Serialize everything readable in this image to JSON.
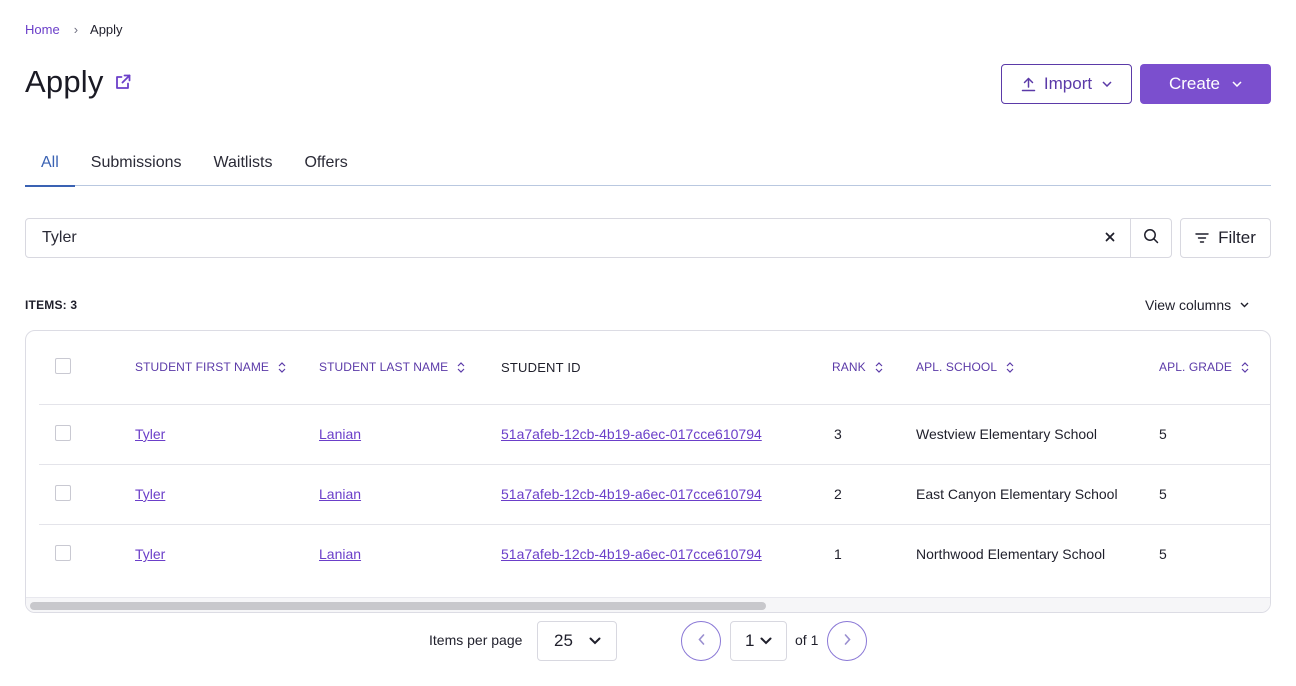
{
  "breadcrumb": {
    "home": "Home",
    "separator": "›",
    "current": "Apply"
  },
  "page": {
    "title": "Apply"
  },
  "header": {
    "import_label": "Import",
    "create_label": "Create"
  },
  "tabs": [
    {
      "label": "All",
      "active": true
    },
    {
      "label": "Submissions",
      "active": false
    },
    {
      "label": "Waitlists",
      "active": false
    },
    {
      "label": "Offers",
      "active": false
    }
  ],
  "search": {
    "value": "Tyler",
    "clear_symbol": "×"
  },
  "filter": {
    "label": "Filter"
  },
  "items": {
    "count_label": "ITEMS: 3"
  },
  "view_columns": {
    "label": "View columns"
  },
  "table": {
    "columns": [
      {
        "label": "STUDENT FIRST NAME",
        "sortable": true
      },
      {
        "label": "STUDENT LAST NAME",
        "sortable": true
      },
      {
        "label": "STUDENT ID",
        "sortable": false
      },
      {
        "label": "RANK",
        "sortable": true
      },
      {
        "label": "APL. SCHOOL",
        "sortable": true
      },
      {
        "label": "APL. GRADE",
        "sortable": true
      }
    ],
    "rows": [
      {
        "first_name": "Tyler",
        "last_name": "Lanian",
        "student_id": "51a7afeb-12cb-4b19-a6ec-017cce610794",
        "rank": "3",
        "school": "Westview Elementary School",
        "grade": "5"
      },
      {
        "first_name": "Tyler",
        "last_name": "Lanian",
        "student_id": "51a7afeb-12cb-4b19-a6ec-017cce610794",
        "rank": "2",
        "school": "East Canyon Elementary School",
        "grade": "5"
      },
      {
        "first_name": "Tyler",
        "last_name": "Lanian",
        "student_id": "51a7afeb-12cb-4b19-a6ec-017cce610794",
        "rank": "1",
        "school": "Northwood Elementary School",
        "grade": "5"
      }
    ]
  },
  "pagination": {
    "per_page_label": "Items per page",
    "per_page_value": "25",
    "current_page": "1",
    "of_label": "of 1"
  },
  "colors": {
    "accent": "#7b4fce",
    "link": "#6b3fc9",
    "tab_active": "#3a62b3",
    "border": "#d8d8e0"
  },
  "icons": {
    "external_link": "external-link-icon",
    "upload": "upload-icon",
    "chevron_down": "chevron-down-icon",
    "close": "close-icon",
    "search": "search-icon",
    "filter": "filter-icon",
    "sort": "sort-icon",
    "chevron_left": "chevron-left-icon",
    "chevron_right": "chevron-right-icon"
  }
}
